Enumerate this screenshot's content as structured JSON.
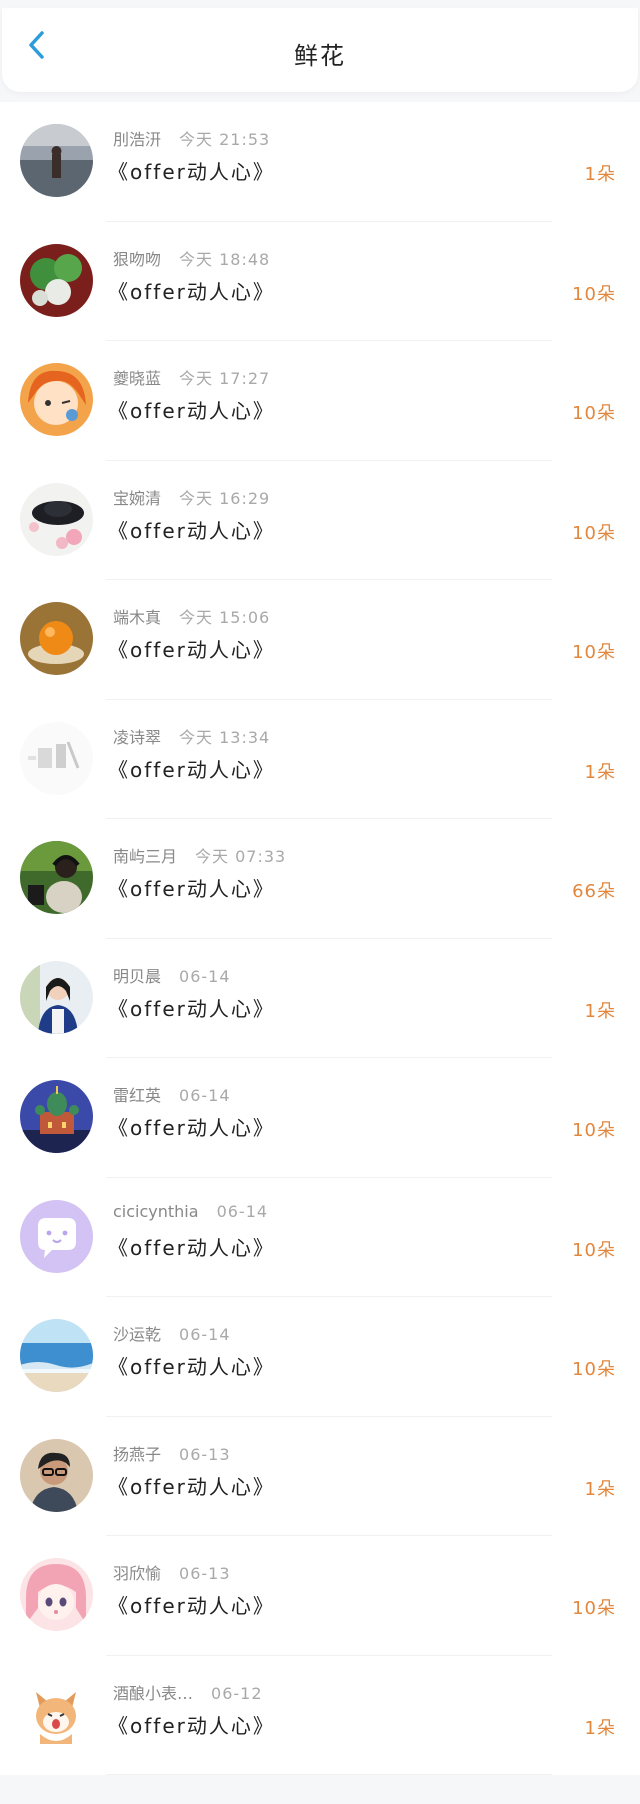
{
  "header": {
    "title": "鲜花",
    "back_icon": "chevron-left-icon",
    "accent_color": "#2d9cdb"
  },
  "items": [
    {
      "name": "刖浩汧",
      "time": "今天 21:53",
      "book": "《offer动人心》",
      "count": "1朵",
      "avatar": "lake-landscape-photo"
    },
    {
      "name": "狠吻吻",
      "time": "今天 18:48",
      "book": "《offer动人心》",
      "count": "10朵",
      "avatar": "vegetables-photo"
    },
    {
      "name": "夔晓蓝",
      "time": "今天 17:27",
      "book": "《offer动人心》",
      "count": "10朵",
      "avatar": "anime-girl-orange-hair"
    },
    {
      "name": "宝婉清",
      "time": "今天 16:29",
      "book": "《offer动人心》",
      "count": "10朵",
      "avatar": "hat-flowers-photo"
    },
    {
      "name": "端木真",
      "time": "今天 15:06",
      "book": "《offer动人心》",
      "count": "10朵",
      "avatar": "orange-fruit-photo"
    },
    {
      "name": "凌诗翠",
      "time": "今天 13:34",
      "book": "《offer动人心》",
      "count": "1朵",
      "avatar": "light-sketch-photo"
    },
    {
      "name": "南屿三月",
      "time": "今天 07:33",
      "book": "《offer动人心》",
      "count": "66朵",
      "avatar": "person-headphones-photo"
    },
    {
      "name": "明贝晨",
      "time": "06-14",
      "book": "《offer动人心》",
      "count": "1朵",
      "avatar": "girl-portrait-photo"
    },
    {
      "name": "雷红英",
      "time": "06-14",
      "book": "《offer动人心》",
      "count": "10朵",
      "avatar": "cathedral-night-photo"
    },
    {
      "name": "cicicynthia",
      "time": "06-14",
      "book": "《offer动人心》",
      "count": "10朵",
      "avatar": "default-chat-avatar"
    },
    {
      "name": "沙运乾",
      "time": "06-14",
      "book": "《offer动人心》",
      "count": "10朵",
      "avatar": "sea-beach-photo"
    },
    {
      "name": "扬燕子",
      "time": "06-13",
      "book": "《offer动人心》",
      "count": "1朵",
      "avatar": "man-glasses-photo"
    },
    {
      "name": "羽欣愉",
      "time": "06-13",
      "book": "《offer动人心》",
      "count": "10朵",
      "avatar": "anime-pink-hair"
    },
    {
      "name": "酒酿小表…",
      "time": "06-12",
      "book": "《offer动人心》",
      "count": "1朵",
      "avatar": "cartoon-cat-sticker"
    }
  ],
  "colors": {
    "count_color": "#e2873c",
    "time_color": "#a9a9a9",
    "name_color": "#888888"
  }
}
